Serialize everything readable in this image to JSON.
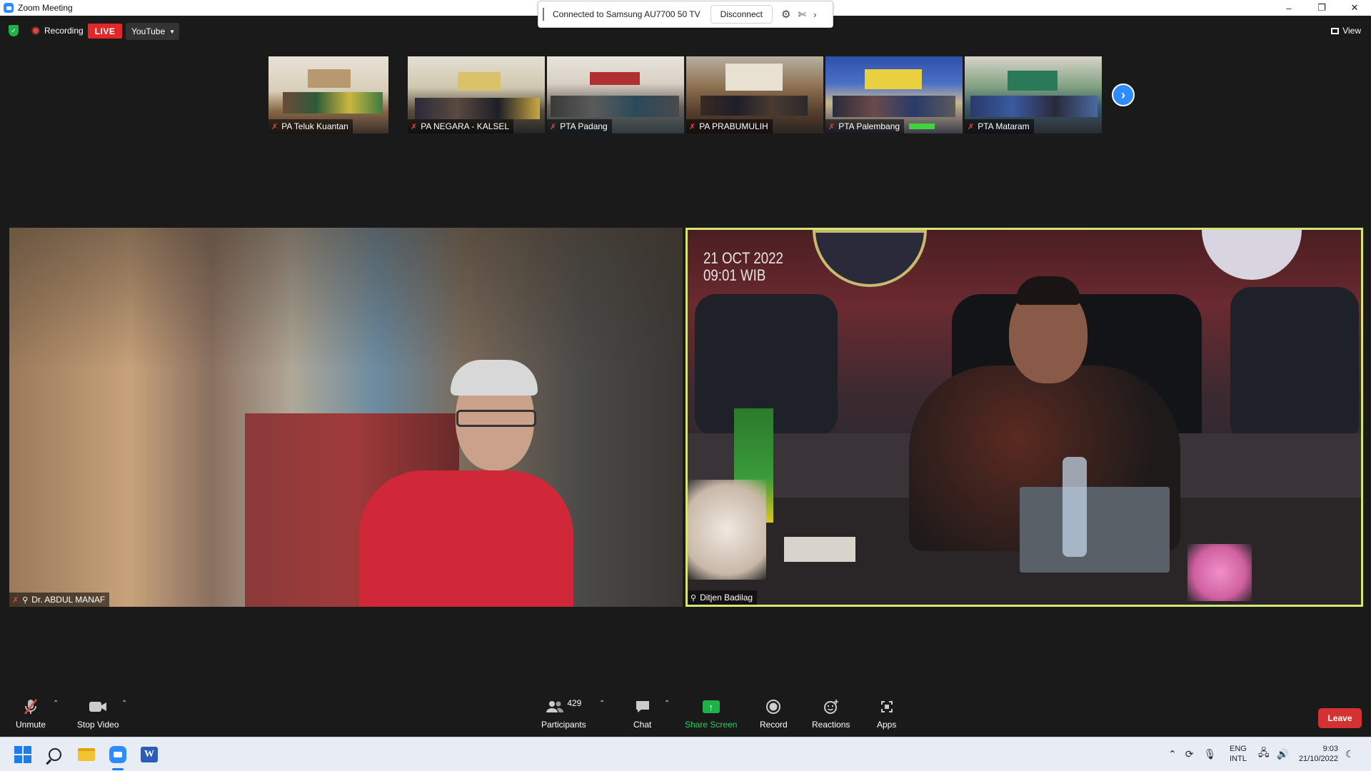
{
  "window": {
    "title": "Zoom Meeting",
    "controls": {
      "minimize": "–",
      "restore": "❐",
      "close": "✕"
    }
  },
  "cast": {
    "status": "Connected to Samsung AU7700 50 TV",
    "disconnect_label": "Disconnect"
  },
  "meeting_bar": {
    "recording_label": "Recording",
    "live_label": "LIVE",
    "stream_target": "YouTube",
    "view_label": "View"
  },
  "thumbnails": [
    {
      "name": "PA Teluk Kuantan"
    },
    {
      "name": "PA NEGARA - KALSEL"
    },
    {
      "name": "PTA Padang"
    },
    {
      "name": "PA PRABUMULIH"
    },
    {
      "name": "PTA Palembang"
    },
    {
      "name": "PTA Mataram"
    }
  ],
  "main_tiles": {
    "left": {
      "name": "Dr. ABDUL MANAF"
    },
    "right": {
      "name": "Ditjen Badilag",
      "overlay_date": "21 OCT 2022",
      "overlay_time": "09:01 WIB"
    }
  },
  "toolbar": {
    "unmute": "Unmute",
    "stop_video": "Stop Video",
    "participants": "Participants",
    "participant_count": "429",
    "chat": "Chat",
    "share_screen": "Share Screen",
    "record": "Record",
    "reactions": "Reactions",
    "apps": "Apps",
    "leave": "Leave"
  },
  "taskbar": {
    "lang_line1": "ENG",
    "lang_line2": "INTL",
    "time": "9:03",
    "date": "21/10/2022"
  },
  "colors": {
    "zoom_blue": "#2d8cff",
    "live_red": "#e02828",
    "share_green": "#1fb24a",
    "active_speaker_border": "#d6e675",
    "leave_red": "#d43232"
  }
}
